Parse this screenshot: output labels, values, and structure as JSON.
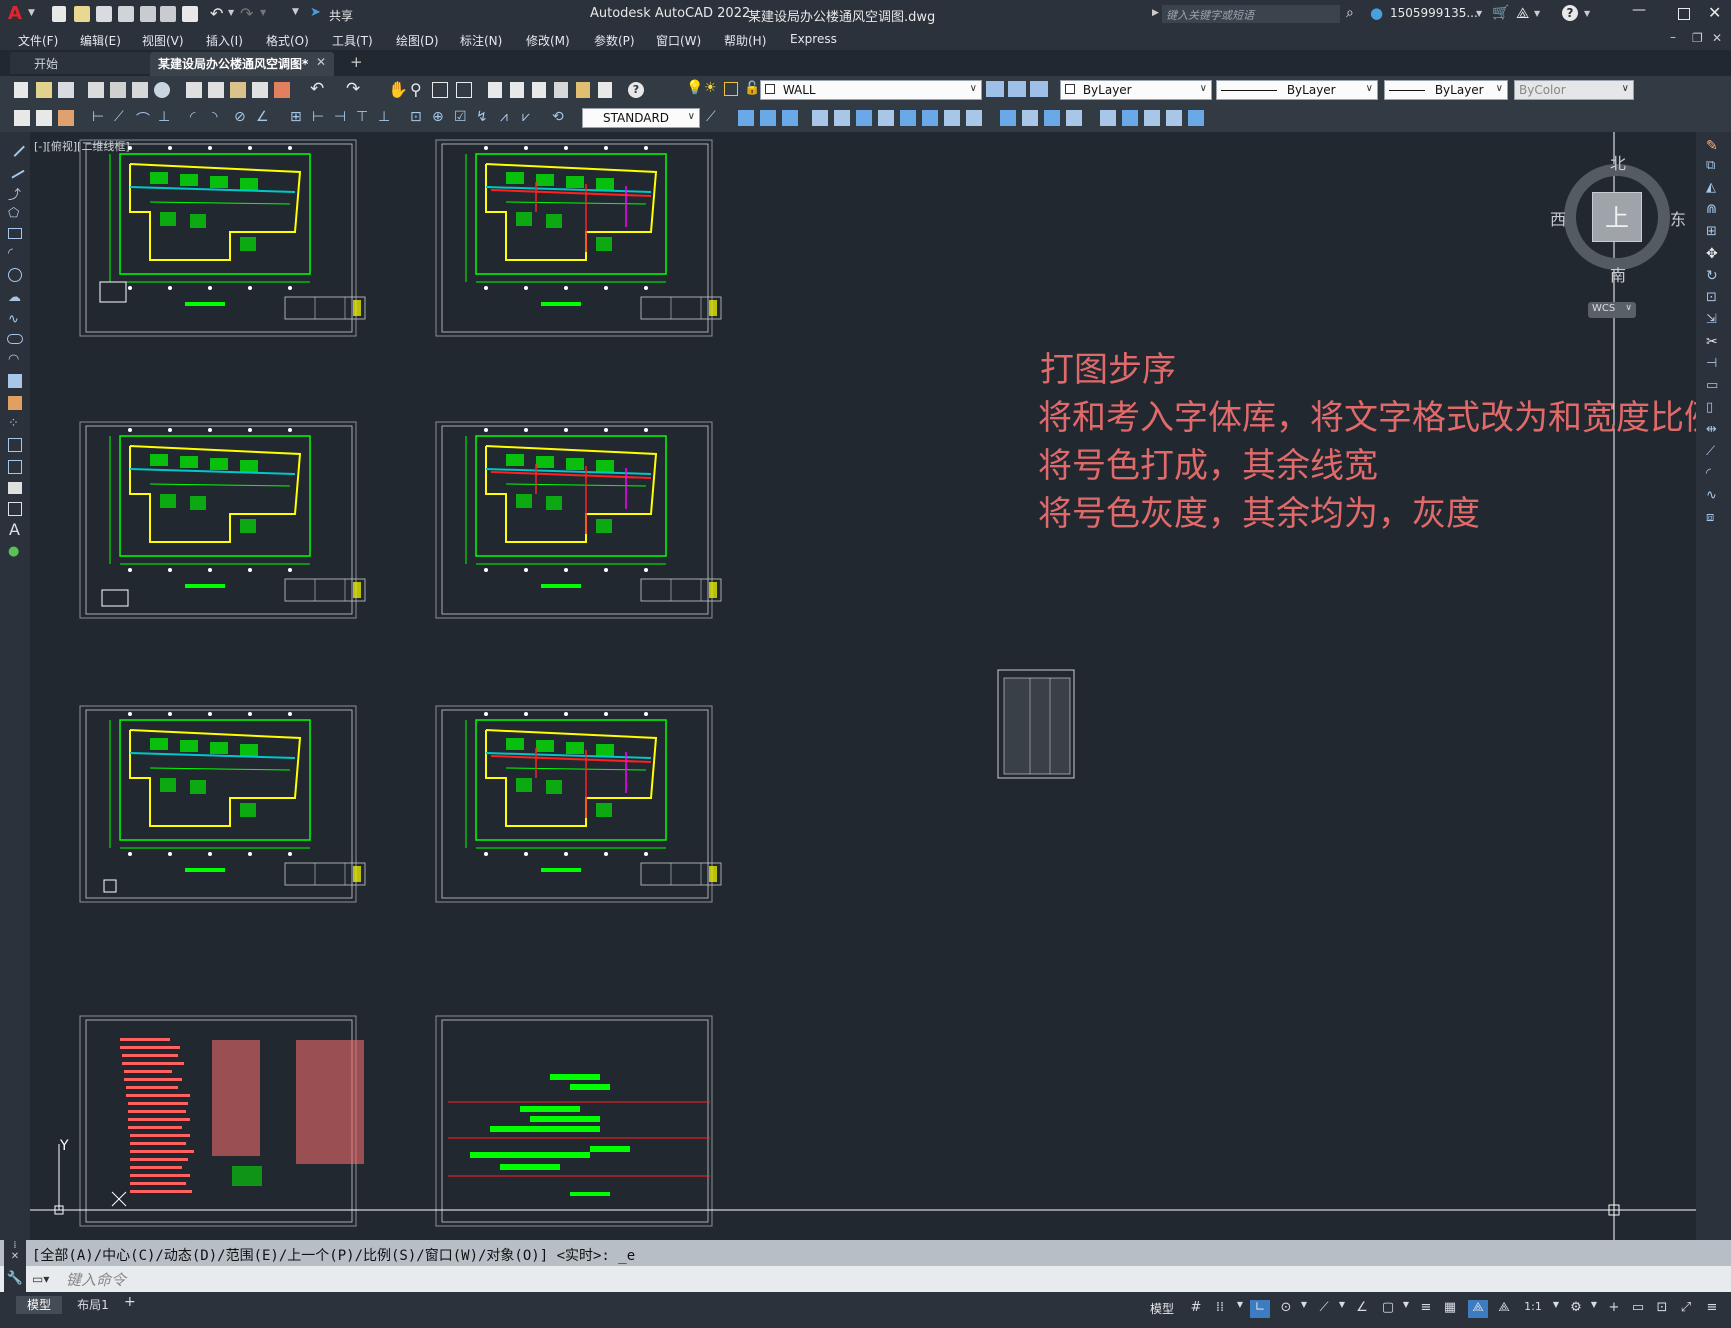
{
  "titlebar": {
    "app_title": "Autodesk AutoCAD 2022",
    "file_name": "某建设局办公楼通风空调图.dwg",
    "share_label": "共享",
    "search_placeholder": "键入关键字或短语",
    "user": "1505999135...",
    "help": "?"
  },
  "menu": [
    "文件(F)",
    "编辑(E)",
    "视图(V)",
    "插入(I)",
    "格式(O)",
    "工具(T)",
    "绘图(D)",
    "标注(N)",
    "修改(M)",
    "参数(P)",
    "窗口(W)",
    "帮助(H)",
    "Express"
  ],
  "tabs": {
    "start": "开始",
    "active": "某建设局办公楼通风空调图*",
    "add": "+"
  },
  "toolbar1": {
    "layer": "WALL",
    "color": "ByLayer",
    "linetype": "ByLayer",
    "lineweight": "ByLayer",
    "plotstyle": "ByColor"
  },
  "toolbar2": {
    "textstyle": "STANDARD"
  },
  "viewport_label": "[-][俯视][二维线框]",
  "viewcube": {
    "north": "北",
    "south": "南",
    "east": "东",
    "west": "西",
    "top": "上",
    "wcs": "WCS"
  },
  "annotation": {
    "line1": "打图步序",
    "line2": "将和考入字体库，将文字格式改为和宽度比例",
    "line3": "将号色打成，其余线宽",
    "line4": "将号色灰度，其余均为，灰度"
  },
  "ucs": {
    "y": "Y"
  },
  "command": {
    "history": "[全部(A)/中心(C)/动态(D)/范围(E)/上一个(P)/比例(S)/窗口(W)/对象(O)] <实时>: _e",
    "placeholder": "键入命令"
  },
  "layout_tabs": [
    "模型",
    "布局1",
    "+"
  ],
  "status": {
    "model": "模型",
    "scale": "1:1"
  },
  "colors": {
    "accent": "#4a9fe0",
    "annotation": "#e06a6a",
    "cad_green": "#00ff00",
    "cad_yellow": "#ffff00",
    "cad_red": "#ff2020",
    "canvas_bg": "#212830"
  }
}
